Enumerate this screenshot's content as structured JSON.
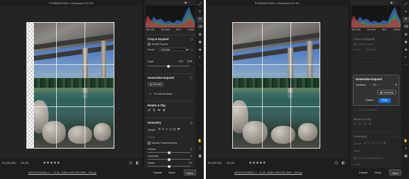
{
  "left": {
    "title": "P1050681.RW2  •  Panasonic DC-S9",
    "bottom": {
      "zoom_fit": "Fit (25.3%)",
      "zoom_pct": "33.2%",
      "stars": "★★★★★"
    },
    "footer": {
      "file_info": "sRGB IEC61966-2.1 - 16 bit - 6288 x 8000 (50.3MP) - 300 ppi",
      "cancel": "Cancel",
      "done": "Done",
      "open": "Open"
    },
    "panel": {
      "exif": [
        "ISO 100",
        "16.0 mm",
        "f/8.0",
        "1/200s"
      ],
      "crop": {
        "title": "Crop & Expand",
        "enable_label": "Enable Expand",
        "preset_label": "Preset",
        "preset_value": "Unlimited",
        "angle_label": "Angle",
        "angle_value": "0.00",
        "angle_unit": "SDR"
      },
      "gen": {
        "title": "Generative Expand",
        "generate": "Generate",
        "feedback": "Provide feedback"
      },
      "rotate": {
        "title": "Rotate & Flip"
      },
      "geometry": {
        "title": "Geometry",
        "upright_label": "Upright",
        "manual_label": "Manual Transformations",
        "vertical": "Vertical",
        "horizontal": "Horizontal",
        "rotate_label": "Rotate",
        "v_val": "0",
        "h_val": "0",
        "r_val": "0.0"
      }
    }
  },
  "right": {
    "title": "P1050681.RW2  •  Panasonic DC-S9",
    "bottom": {
      "zoom_fit": "Fit (25.3%)",
      "zoom_pct": "33.2%",
      "stars": "★★★★★"
    },
    "footer": {
      "file_info": "sRGB IEC61966-2.1 - 16 bit - 6288 x 8000 (50.3MP) - 300 ppi",
      "cancel": "Cancel",
      "done": "Done",
      "open": "Open"
    },
    "panel": {
      "exif": [
        "ISO 100",
        "16.0 mm",
        "f/8.0",
        "1/200s"
      ],
      "crop": {
        "title": "Crop & Expand",
        "enable_label": "Enable Expand",
        "preset_label": "Preset",
        "preset_value": "Unlimited"
      },
      "popup": {
        "title": "Generative Expand",
        "variations_label": "Variations",
        "variations_value": "3/3",
        "generate": "Generate",
        "cancel": "Cancel",
        "keep": "Keep"
      },
      "feedback": "Provide feedback",
      "rotate": {
        "title": "Rotate & Flip"
      },
      "geometry": {
        "title": "Geometry",
        "upright_label": "Upright",
        "manual_label": "Manual Transformations",
        "rotate_label": "Rotate"
      }
    }
  },
  "colors": {
    "accent": "#1473e6",
    "panel_bg": "#262626",
    "app_bg": "#1e1e1e"
  }
}
